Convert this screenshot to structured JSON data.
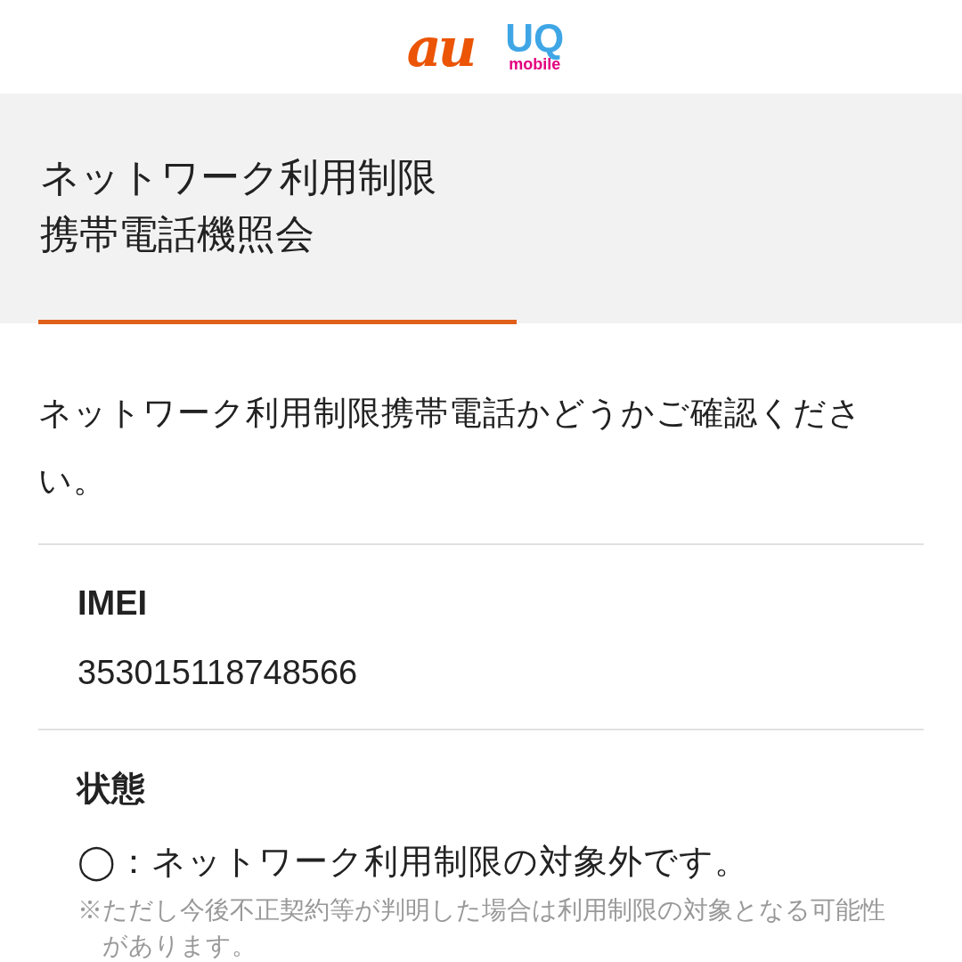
{
  "logos": {
    "au": "au",
    "uq": "UQ",
    "uq_sub": "mobile"
  },
  "title": [
    "ネットワーク利用制限",
    "携帯電話機照会"
  ],
  "description": "ネットワーク利用制限携帯電話かどうかご確認ください。",
  "fields": [
    {
      "label": "IMEI",
      "value": "353015118748566"
    }
  ],
  "status": {
    "label": "状態",
    "result": "◯：ネットワーク利用制限の対象外です。",
    "note": "※ただし今後不正契約等が判明した場合は利用制限の対象となる可能性があります。"
  }
}
